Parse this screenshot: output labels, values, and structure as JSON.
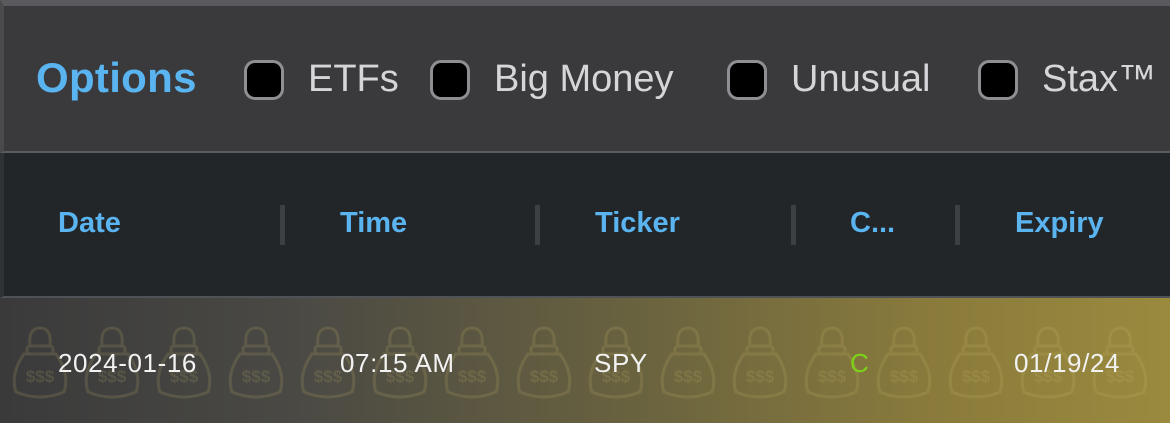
{
  "filters": {
    "title": "Options",
    "items": [
      {
        "label": "ETFs",
        "checked": false
      },
      {
        "label": "Big Money",
        "checked": false
      },
      {
        "label": "Unusual",
        "checked": false
      },
      {
        "label": "Stax™",
        "checked": false
      }
    ]
  },
  "table": {
    "columns": [
      "Date",
      "Time",
      "Ticker",
      "C...",
      "Expiry"
    ],
    "rows": [
      {
        "date": "2024-01-16",
        "time": "07:15 AM",
        "ticker": "SPY",
        "call_put": "C",
        "expiry": "01/19/24"
      }
    ],
    "row_icon": "money-bag-icon",
    "row_icon_text": "$$$"
  },
  "colors": {
    "accent": "#5ab4f0",
    "call": "#7cd319",
    "row_highlight": "#9a8a3e"
  }
}
